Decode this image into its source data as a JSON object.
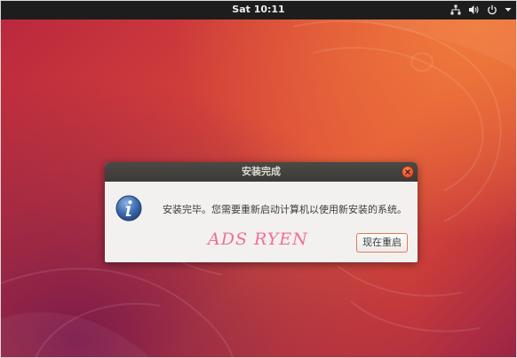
{
  "topbar": {
    "clock": "Sat 10:11",
    "indicators": [
      "network-icon",
      "volume-icon",
      "power-icon",
      "menu-arrow-icon"
    ]
  },
  "dialog": {
    "title": "安装完成",
    "icon": "info-icon",
    "message": "安装完毕。您需要重新启动计算机以使用新安装的系统。",
    "restart_label": "现在重启",
    "close_icon": "close-icon"
  },
  "watermark": {
    "text": "ADS RYEN",
    "color": "#f36d9a"
  },
  "colors": {
    "topbar": "#1d1d1d",
    "dialog_titlebar": "#3c3b37",
    "close_button": "#e0512b",
    "accent": "#e17b53"
  }
}
